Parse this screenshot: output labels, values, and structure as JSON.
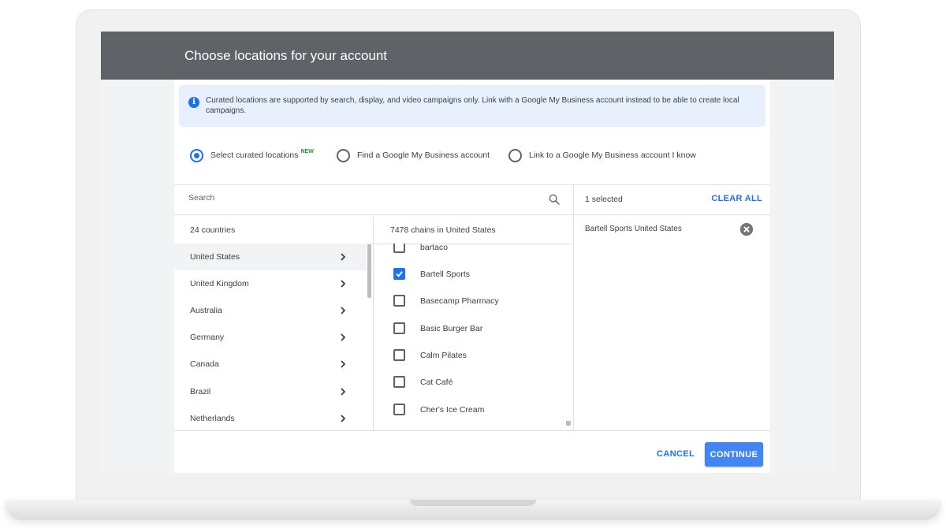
{
  "dialog": {
    "title": "Choose locations for your account"
  },
  "info_banner": {
    "icon": "info-icon",
    "text": "Curated locations are supported by search, display, and video campaigns only. Link with a Google My Business account instead to be able to create local campaigns."
  },
  "location_options": [
    {
      "label": "Select curated locations",
      "badge": "NEW",
      "selected": true
    },
    {
      "label": "Find a Google My Business account",
      "selected": false
    },
    {
      "label": "Link to a Google My Business account I know",
      "selected": false
    }
  ],
  "search": {
    "placeholder": "Search",
    "icon": "search-icon"
  },
  "selected_panel": {
    "count_label": "1 selected",
    "clear_label": "CLEAR ALL",
    "items": [
      {
        "label": "Bartell Sports  United States",
        "remove_icon": "close-circle-icon"
      }
    ]
  },
  "countries": {
    "header": "24 countries",
    "items": [
      {
        "name": "United States",
        "active": true
      },
      {
        "name": "United Kingdom",
        "active": false
      },
      {
        "name": "Australia",
        "active": false
      },
      {
        "name": "Germany",
        "active": false
      },
      {
        "name": "Canada",
        "active": false
      },
      {
        "name": "Brazil",
        "active": false
      },
      {
        "name": "Netherlands",
        "active": false
      }
    ]
  },
  "chains": {
    "header": "7478 chains in United States",
    "items": [
      {
        "name": "bartaco",
        "checked": false
      },
      {
        "name": "Bartell Sports",
        "checked": true
      },
      {
        "name": "Basecamp Pharmacy",
        "checked": false
      },
      {
        "name": "Basic Burger Bar",
        "checked": false
      },
      {
        "name": "Calm Pilates",
        "checked": false
      },
      {
        "name": "Cat Café",
        "checked": false
      },
      {
        "name": "Cher's Ice Cream",
        "checked": false
      }
    ]
  },
  "footer": {
    "cancel_label": "CANCEL",
    "continue_label": "CONTINUE"
  },
  "colors": {
    "title_bar": "#5f6368",
    "accent": "#1a73e8",
    "primary_button": "#4285f4",
    "banner_bg": "#e8f0fe",
    "new_badge": "#1e8e3e"
  }
}
